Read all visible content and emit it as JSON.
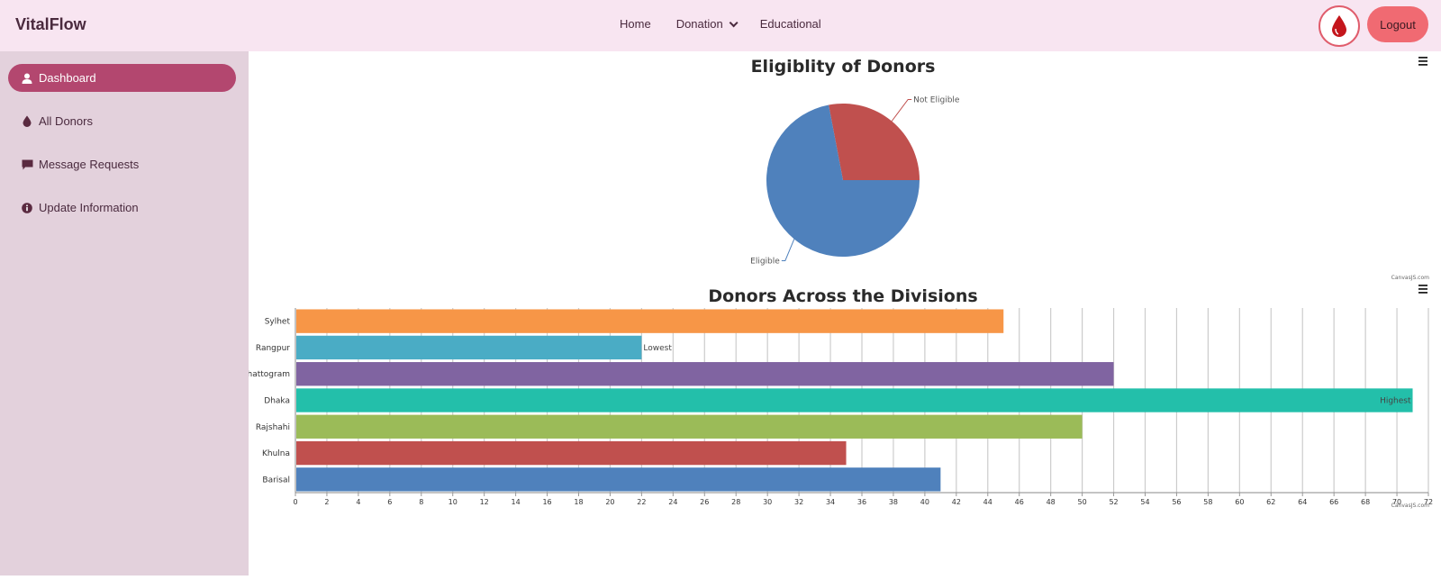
{
  "header": {
    "brand": "VitalFlow",
    "nav": {
      "home": "Home",
      "donation": "Donation",
      "educational": "Educational"
    },
    "logout_label": "Logout",
    "drop_icon": "blood-drop-icon"
  },
  "sidebar": {
    "items": [
      {
        "label": "Dashboard",
        "icon": "user-icon",
        "active": true
      },
      {
        "label": "All Donors",
        "icon": "drop-icon",
        "active": false
      },
      {
        "label": "Message Requests",
        "icon": "message-icon",
        "active": false
      },
      {
        "label": "Update Information",
        "icon": "info-icon",
        "active": false
      }
    ]
  },
  "colors": {
    "topbar": "#f8e5f1",
    "sidebar": "#e3d1dc",
    "active": "#b3476f",
    "logout": "#f06a72"
  },
  "chart_data": [
    {
      "type": "pie",
      "title": "Eligiblity of Donors",
      "credit": "CanvasJS.com",
      "slices": [
        {
          "label": "Not Eligible",
          "value": 28,
          "color": "#c0504e"
        },
        {
          "label": "Eligible",
          "value": 72,
          "color": "#4f81bc"
        }
      ]
    },
    {
      "type": "bar",
      "orientation": "horizontal",
      "title": "Donors Across the Divisions",
      "credit": "CanvasJS.com",
      "categories": [
        "Barisal",
        "Khulna",
        "Rajshahi",
        "Dhaka",
        "Chattogram",
        "Rangpur",
        "Sylhet"
      ],
      "values": [
        41,
        35,
        50,
        71,
        52,
        22,
        45
      ],
      "colors": [
        "#4f81bc",
        "#c0504e",
        "#9bbb58",
        "#23bfaa",
        "#8064a1",
        "#4aacc5",
        "#f79647"
      ],
      "index_labels": {
        "Rangpur": "Lowest",
        "Dhaka": "Highest"
      },
      "xlim": [
        0,
        72
      ],
      "tick_interval": 2,
      "grid": true
    }
  ]
}
